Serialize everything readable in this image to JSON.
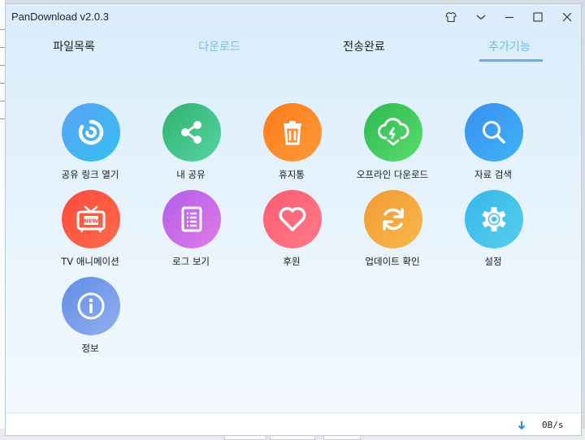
{
  "window": {
    "title": "PanDownload v2.0.3"
  },
  "tabs": [
    {
      "label": "파일목록"
    },
    {
      "label": "다운로드"
    },
    {
      "label": "전송완료"
    },
    {
      "label": "추가기능"
    }
  ],
  "active_tab": "추가기능",
  "features": [
    {
      "label": "공유 링크 열기",
      "icon": "share-link-icon",
      "colors": [
        "#5aa2f5",
        "#34c0f2"
      ]
    },
    {
      "label": "내 공유",
      "icon": "share-icon",
      "colors": [
        "#2fb26f",
        "#56d4a3"
      ]
    },
    {
      "label": "휴지통",
      "icon": "trash-icon",
      "colors": [
        "#ff7a18",
        "#ff9a3c"
      ]
    },
    {
      "label": "오프라인 다운로드",
      "icon": "cloud-download-icon",
      "colors": [
        "#2cb84f",
        "#5bdd6d"
      ]
    },
    {
      "label": "자료 검색",
      "icon": "search-icon",
      "colors": [
        "#3a8ef0",
        "#40b4f5"
      ]
    },
    {
      "label": "TV 애니메이션",
      "icon": "tv-icon",
      "colors": [
        "#ff4a3d",
        "#ff6b4a"
      ]
    },
    {
      "label": "로그 보기",
      "icon": "log-icon",
      "colors": [
        "#b25ee8",
        "#e17be9"
      ]
    },
    {
      "label": "후원",
      "icon": "heart-icon",
      "colors": [
        "#ff5b70",
        "#ff7b88"
      ]
    },
    {
      "label": "업데이트 확인",
      "icon": "refresh-icon",
      "colors": [
        "#f29a32",
        "#f7b84c"
      ]
    },
    {
      "label": "설정",
      "icon": "gear-icon",
      "colors": [
        "#36b5e8",
        "#56d0ee"
      ]
    },
    {
      "label": "정보",
      "icon": "info-icon",
      "colors": [
        "#5f8ee6",
        "#93aef0"
      ]
    }
  ],
  "status": {
    "speed": "0B/s",
    "speed_icon": "download-arrow-icon"
  }
}
